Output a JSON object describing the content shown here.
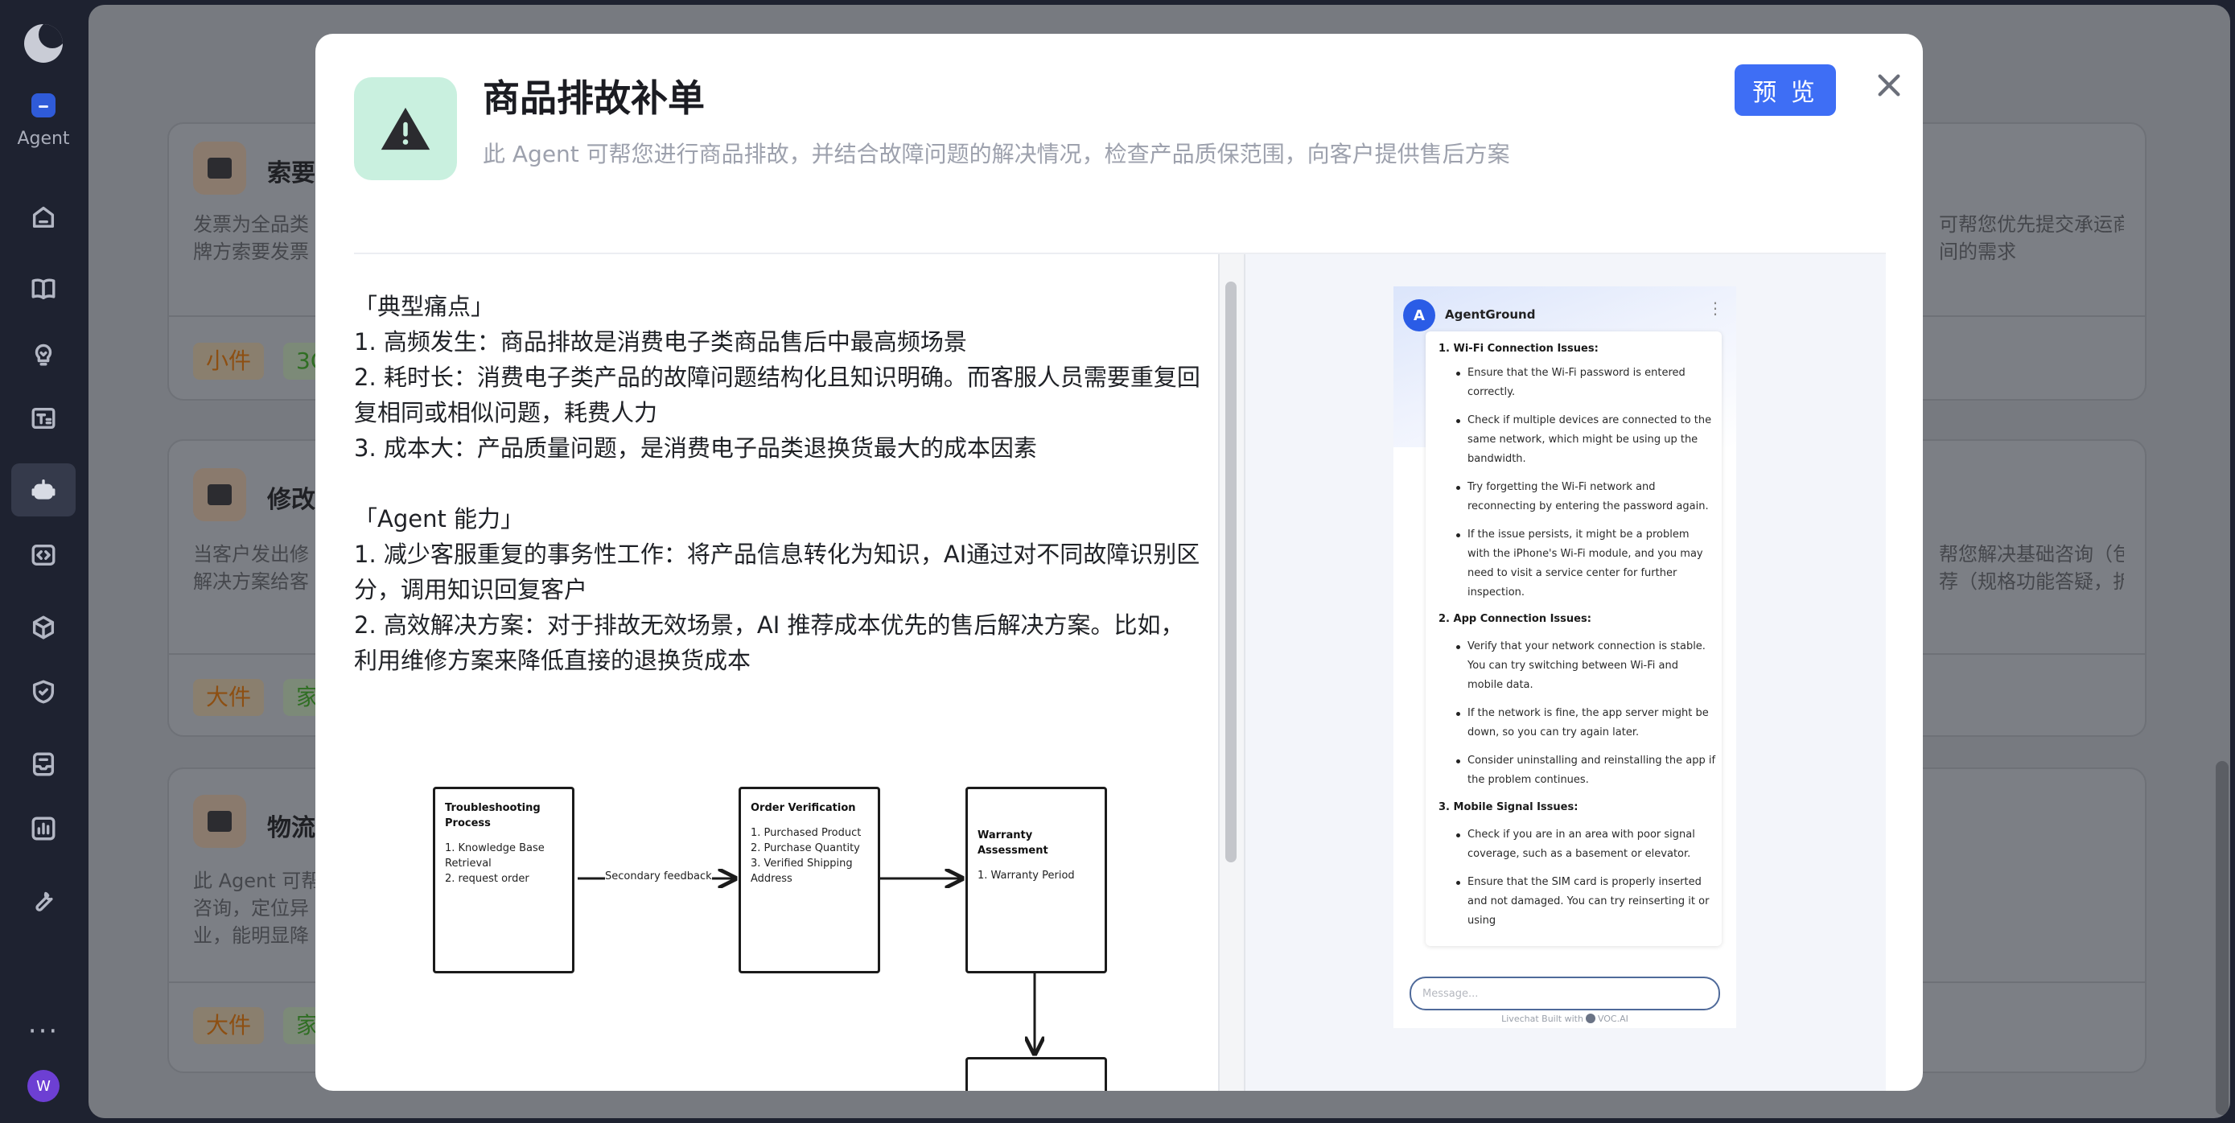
{
  "sidebar": {
    "agent_label": "Agent",
    "icons": [
      "home-icon",
      "book-icon",
      "lightbulb-icon",
      "text-icon",
      "robot-icon",
      "code-icon",
      "cube-icon",
      "shield-icon",
      "inbox-icon",
      "chart-icon",
      "wrench-icon"
    ],
    "more": "···",
    "avatar_initial": "W"
  },
  "background": {
    "cards": [
      {
        "title": "索要",
        "desc": [
          "发票为全品类",
          "牌方索要发票"
        ],
        "desc_right": [
          "可帮您优先提交承运商",
          "间的需求"
        ],
        "tags": [
          {
            "text": "小件",
            "color": "orange"
          },
          {
            "text": "3C",
            "color": "green"
          }
        ]
      },
      {
        "title": "修改",
        "desc": [
          "当客户发出修",
          "解决方案给客"
        ],
        "desc_right": [
          "帮您解决基础咨询（包",
          "荐（规格功能答疑，折"
        ],
        "tags": [
          {
            "text": "大件",
            "color": "orange"
          },
          {
            "text": "家",
            "color": "green"
          }
        ]
      },
      {
        "title": "物流",
        "desc": [
          "此 Agent 可帮",
          "咨询，定位异",
          "业，能明显降"
        ],
        "desc_right": [],
        "tags": [
          {
            "text": "大件",
            "color": "orange"
          },
          {
            "text": "家",
            "color": "green"
          }
        ]
      }
    ]
  },
  "modal": {
    "title": "商品排故补单",
    "subtitle": "此 Agent 可帮您进行商品排故，并结合故障问题的解决情况，检查产品质保范围，向客户提供售后方案",
    "preview_label": "预 览",
    "body_lines": [
      "「典型痛点」",
      "1. 高频发生：商品排故是消费电子类商品售后中最高频场景",
      "2. 耗时长：消费电子类产品的故障问题结构化且知识明确。而客服人员需要重复回",
      "复相同或相似问题，耗费人力",
      "3. 成本大：产品质量问题，是消费电子品类退换货最大的成本因素",
      "",
      "「Agent 能力」",
      "1. 减少客服重复的事务性工作：将产品信息转化为知识，AI通过对不同故障识别区",
      "分，调用知识回复客户",
      "2. 高效解决方案：对于排故无效场景，AI 推荐成本优先的售后解决方案。比如，",
      "利用维修方案来降低直接的退换货成本"
    ],
    "flowchart": {
      "box1": {
        "title": [
          "Troubleshooting",
          "Process"
        ],
        "lines": [
          "1. Knowledge Base",
          "Retrieval",
          "2. request order"
        ]
      },
      "arrow1_label": "Secondary feedback",
      "box2": {
        "title": [
          "Order Verification"
        ],
        "lines": [
          "1. Purchased Product",
          "2. Purchase Quantity",
          "3. Verified Shipping",
          "Address"
        ]
      },
      "box3": {
        "title": [
          "Warranty Assessment"
        ],
        "lines": [
          "1. Warranty Period"
        ]
      }
    },
    "chat": {
      "avatar_initial": "A",
      "agent_name": "AgentGround",
      "menu": "⋮",
      "sections": [
        {
          "heading": "1. Wi-Fi Connection Issues:",
          "bullets": [
            [
              "Ensure that the Wi-Fi password is entered",
              "correctly."
            ],
            [
              "Check if multiple devices are connected to the",
              "same network, which might be using up the",
              "bandwidth."
            ],
            [
              "Try forgetting the Wi-Fi network and",
              "reconnecting by entering the password again."
            ],
            [
              "If the issue persists, it might be a problem",
              "with the iPhone's Wi-Fi module, and you may",
              "need to visit a service center for further",
              "inspection."
            ]
          ]
        },
        {
          "heading": "2. App Connection Issues:",
          "bullets": [
            [
              "Verify that your network connection is stable.",
              "You can try switching between Wi-Fi and",
              "mobile data."
            ],
            [
              "If the network is fine, the app server might be",
              "down, so you can try again later."
            ],
            [
              "Consider uninstalling and reinstalling the app if",
              "the problem continues."
            ]
          ]
        },
        {
          "heading": "3. Mobile Signal Issues:",
          "bullets": [
            [
              "Check if you are in an area with poor signal",
              "coverage, such as a basement or elevator."
            ],
            [
              "Ensure that the SIM card is properly inserted",
              "and not damaged. You can try reinserting it or",
              "using"
            ]
          ]
        }
      ],
      "input_placeholder": "Message...",
      "powered_prefix": "Livechat Built with",
      "powered_brand": "VOC.AI"
    }
  }
}
